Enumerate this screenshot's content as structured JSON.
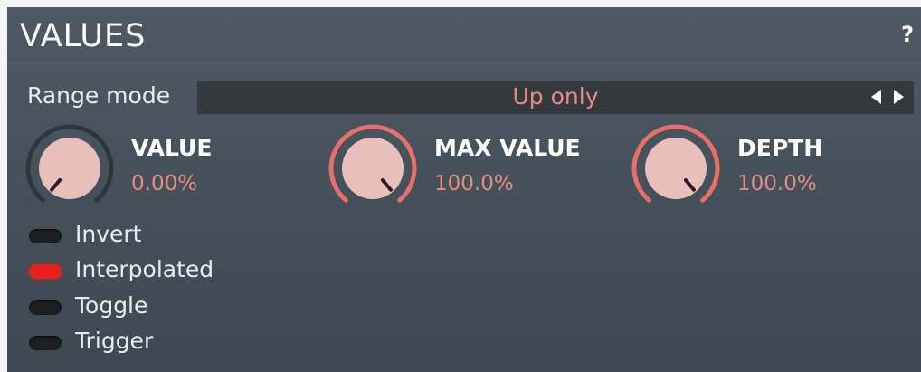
{
  "section": {
    "title": "VALUES",
    "help_label": "?"
  },
  "range_mode": {
    "label": "Range mode",
    "value": "Up only"
  },
  "knobs": [
    {
      "title": "VALUE",
      "value": "0.00%",
      "level": 0.0
    },
    {
      "title": "MAX VALUE",
      "value": "100.0%",
      "level": 1.0
    },
    {
      "title": "DEPTH",
      "value": "100.0%",
      "level": 1.0
    }
  ],
  "toggles": [
    {
      "label": "Invert",
      "on": false
    },
    {
      "label": "Interpolated",
      "on": true
    },
    {
      "label": "Toggle",
      "on": false
    },
    {
      "label": "Trigger",
      "on": false
    }
  ],
  "colors": {
    "accent": "#e98a82",
    "ring_active": "#e8706a",
    "led_on": "#e8201c"
  }
}
